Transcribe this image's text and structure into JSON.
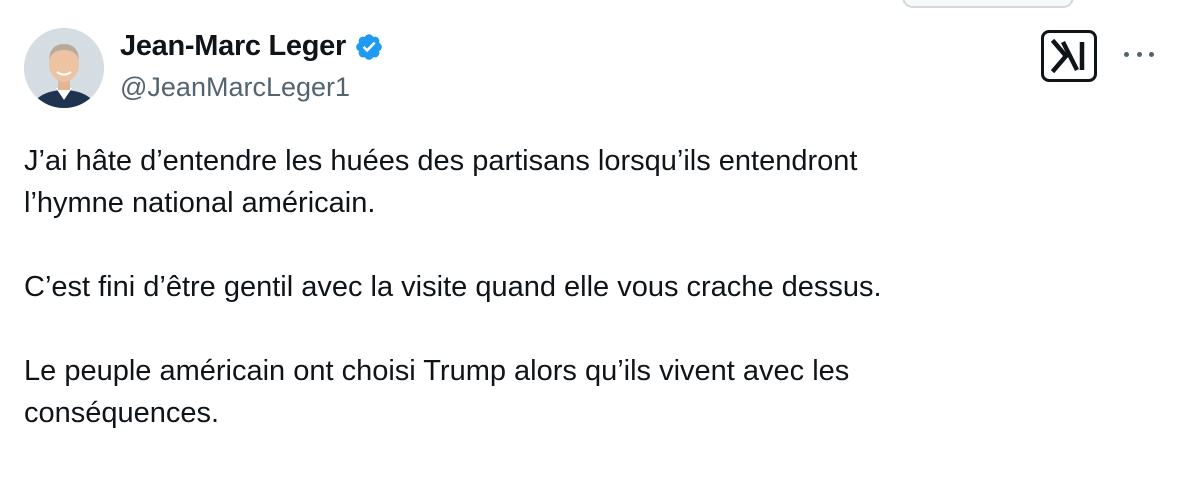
{
  "author": {
    "display_name": "Jean-Marc Leger",
    "handle": "@JeanMarcLeger1",
    "verified": true,
    "verified_icon": "verified-badge-icon",
    "verified_color": "#1d9bf0"
  },
  "toolbar": {
    "brand_icon": "x-logo-icon",
    "more_icon": "more-options-icon"
  },
  "tweet": {
    "paragraphs": [
      "J’ai hâte d’entendre les huées des partisans lorsqu’ils entendront\nl’hymne national américain.",
      "C’est fini d’être gentil avec la visite quand elle vous crache dessus.",
      "Le peuple américain ont choisi Trump alors qu’ils vivent avec les\nconséquences."
    ]
  }
}
